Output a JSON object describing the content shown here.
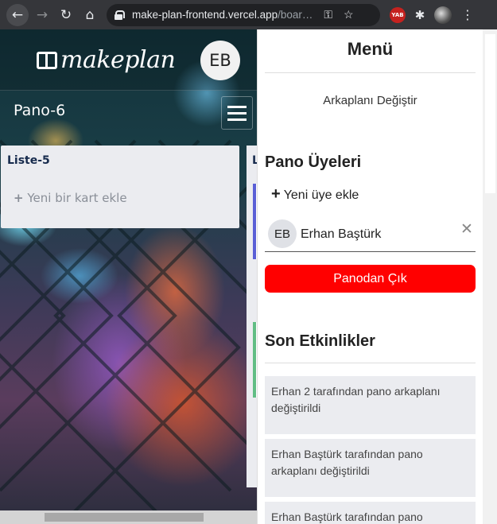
{
  "browser": {
    "url_main": "make-plan-frontend.vercel.app",
    "url_rest": "/boar…",
    "extension_badge": "YAB"
  },
  "app": {
    "logo_text": "makeplan",
    "user_initials": "EB",
    "board_title": "Pano-6"
  },
  "lists": [
    {
      "title": "Liste-5",
      "add_card_label": "Yeni bir kart ekle"
    },
    {
      "title": "L"
    }
  ],
  "menu": {
    "title": "Menü",
    "change_background": "Arkaplanı Değiştir",
    "members_title": "Pano Üyeleri",
    "add_member_label": "Yeni üye ekle",
    "members": [
      {
        "initials": "EB",
        "name": "Erhan Baştürk"
      }
    ],
    "leave_button": "Panodan Çık",
    "activities_title": "Son Etkinlikler",
    "activities": [
      "Erhan 2 tarafından pano arkaplanı değiştirildi",
      "Erhan Baştürk tarafından pano arkaplanı değiştirildi",
      "Erhan Baştürk tarafından pano"
    ]
  },
  "colors": {
    "leave_button": "#ff0000",
    "list_bg": "#ebecf0",
    "card_accent_1": "#5a5fd6",
    "card_accent_2": "#61bd84"
  },
  "icons": [
    "back-icon",
    "forward-icon",
    "reload-icon",
    "home-icon",
    "lock-icon",
    "key-icon",
    "star-icon",
    "puzzle-icon",
    "kebab-icon",
    "hamburger-icon",
    "plus-icon",
    "close-icon"
  ]
}
